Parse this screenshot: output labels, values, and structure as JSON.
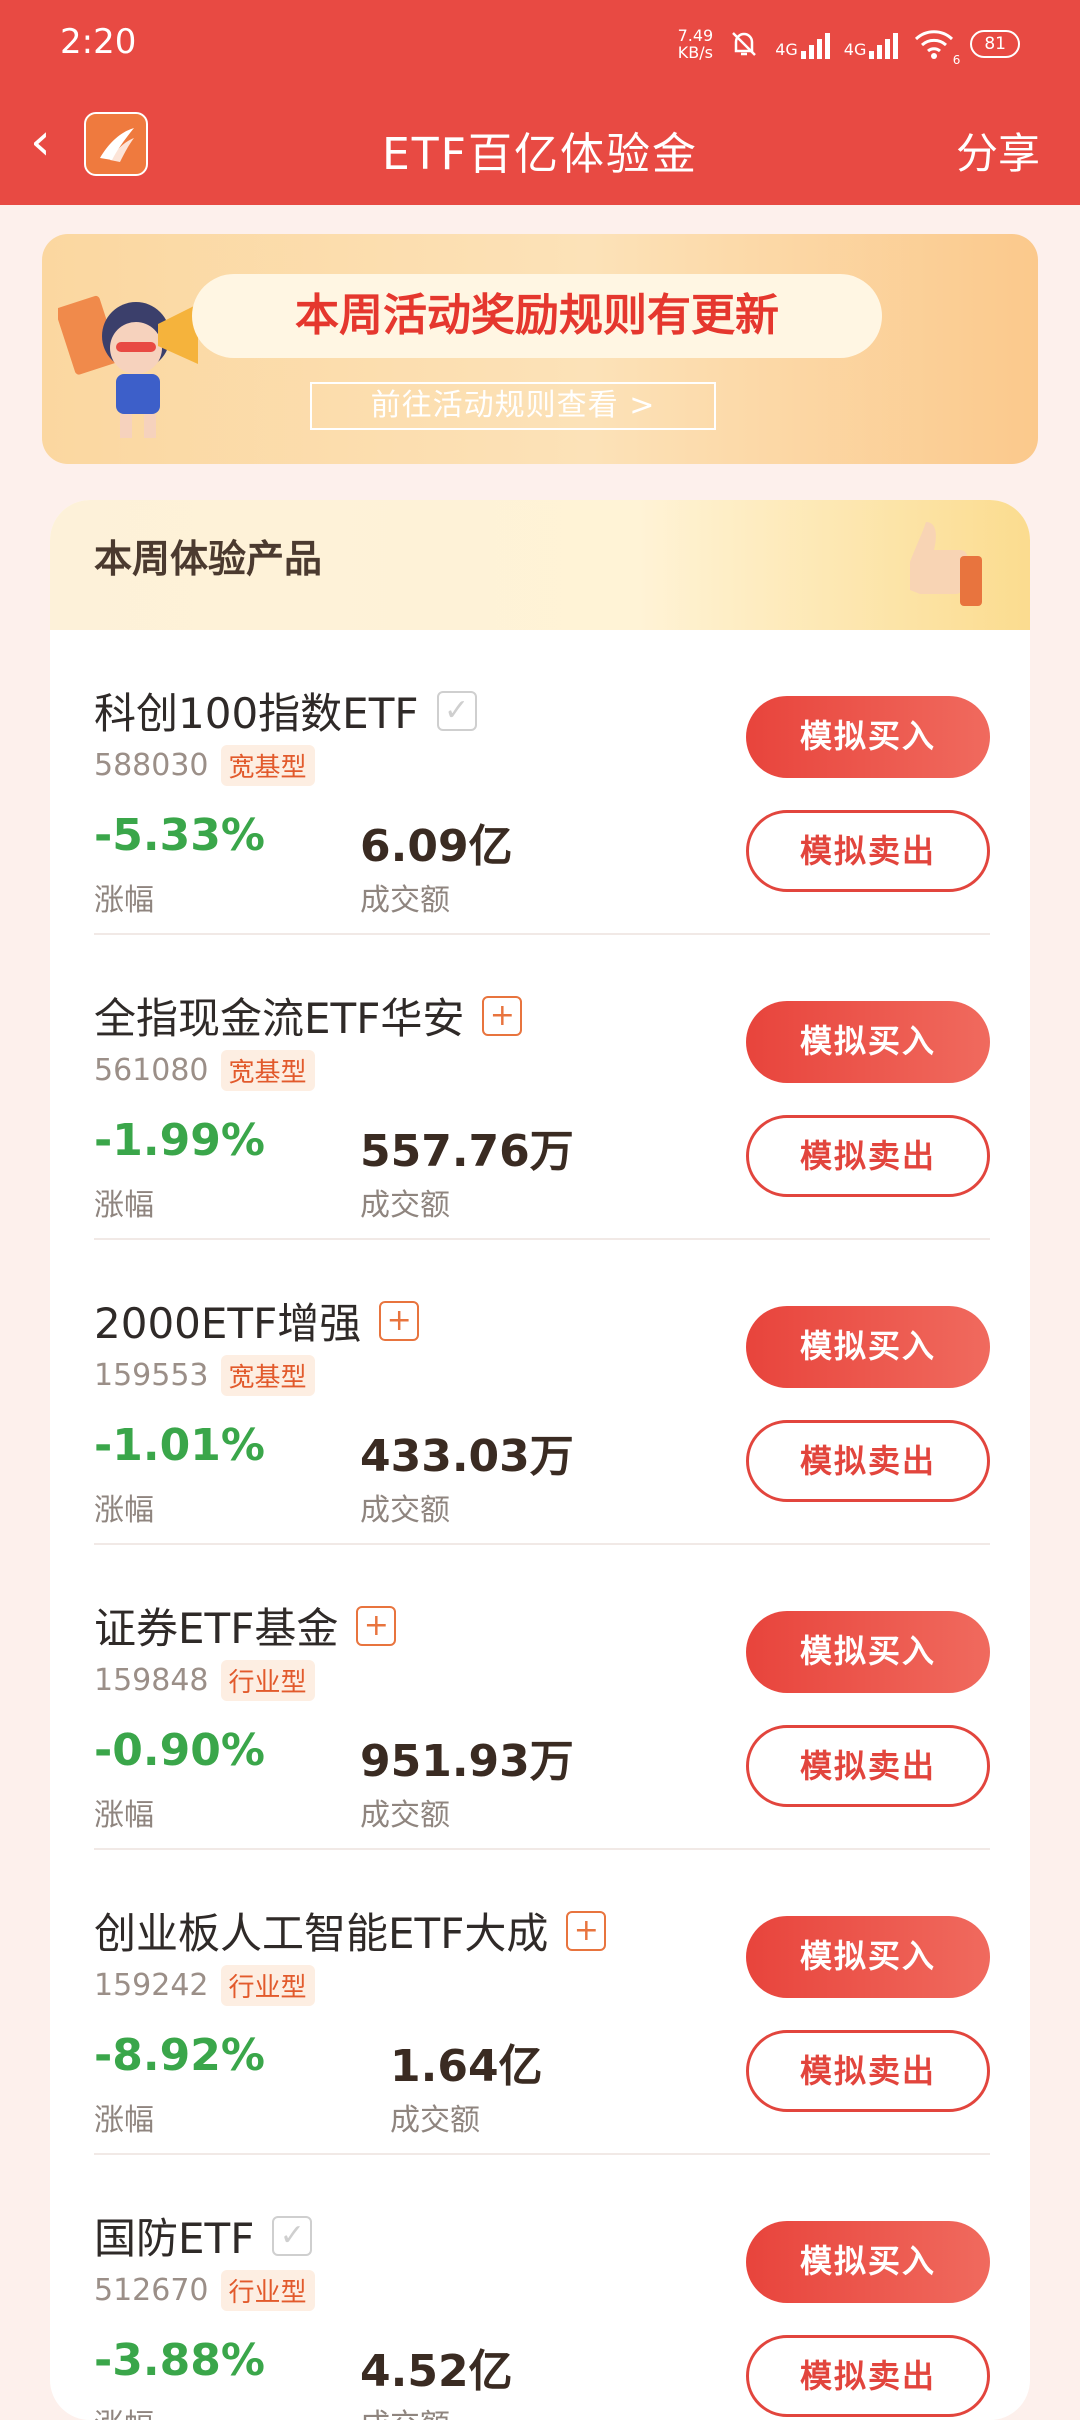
{
  "status_bar": {
    "time": "2:20",
    "net_speed_value": "7.49",
    "net_speed_unit": "KB/s",
    "signal_1": "4G",
    "signal_2": "4G",
    "wifi_badge": "6",
    "battery": "81"
  },
  "header": {
    "title": "ETF百亿体验金",
    "share_label": "分享",
    "back_glyph": "‹"
  },
  "banner": {
    "headline": "本周活动奖励规则有更新",
    "link_label": "前往活动规则查看 >"
  },
  "card": {
    "title": "本周体验产品"
  },
  "products": [
    {
      "name": "科创100指数ETF",
      "mark": "check",
      "mark_glyph": "✓",
      "code": "588030",
      "tag": "宽基型",
      "change": "-5.33%",
      "change_label": "涨幅",
      "volume": "6.09亿",
      "volume_label": "成交额",
      "buy_label": "模拟买入",
      "sell_label": "模拟卖出"
    },
    {
      "name": "全指现金流ETF华安",
      "mark": "plus",
      "mark_glyph": "+",
      "code": "561080",
      "tag": "宽基型",
      "change": "-1.99%",
      "change_label": "涨幅",
      "volume": "557.76万",
      "volume_label": "成交额",
      "buy_label": "模拟买入",
      "sell_label": "模拟卖出"
    },
    {
      "name": "2000ETF增强",
      "mark": "plus",
      "mark_glyph": "+",
      "code": "159553",
      "tag": "宽基型",
      "change": "-1.01%",
      "change_label": "涨幅",
      "volume": "433.03万",
      "volume_label": "成交额",
      "buy_label": "模拟买入",
      "sell_label": "模拟卖出"
    },
    {
      "name": "证券ETF基金",
      "mark": "plus",
      "mark_glyph": "+",
      "code": "159848",
      "tag": "行业型",
      "change": "-0.90%",
      "change_label": "涨幅",
      "volume": "951.93万",
      "volume_label": "成交额",
      "buy_label": "模拟买入",
      "sell_label": "模拟卖出"
    },
    {
      "name": "创业板人工智能ETF大成",
      "mark": "plus",
      "mark_glyph": "+",
      "code": "159242",
      "tag": "行业型",
      "change": "-8.92%",
      "change_label": "涨幅",
      "volume": "1.64亿",
      "volume_label": "成交额",
      "buy_label": "模拟买入",
      "sell_label": "模拟卖出"
    },
    {
      "name": "国防ETF",
      "mark": "check",
      "mark_glyph": "✓",
      "code": "512670",
      "tag": "行业型",
      "change": "-3.88%",
      "change_label": "涨幅",
      "volume": "4.52亿",
      "volume_label": "成交额",
      "buy_label": "模拟买入",
      "sell_label": "模拟卖出"
    }
  ],
  "colors": {
    "header_bg": "#e84a43",
    "change_green": "#3aa64a",
    "buy_red": "#e8443c"
  }
}
